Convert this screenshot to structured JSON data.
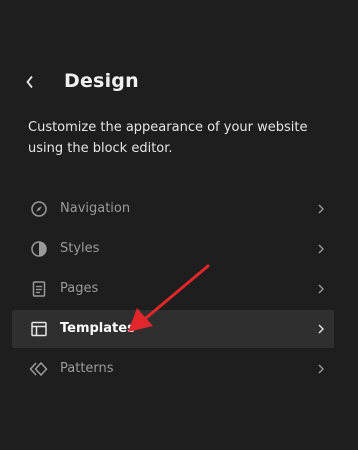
{
  "header": {
    "title": "Design",
    "description": "Customize the appearance of your website using the block editor."
  },
  "menu": {
    "items": [
      {
        "label": "Navigation",
        "icon": "navigation-compass-icon",
        "active": false
      },
      {
        "label": "Styles",
        "icon": "styles-half-circle-icon",
        "active": false
      },
      {
        "label": "Pages",
        "icon": "pages-document-icon",
        "active": false
      },
      {
        "label": "Templates",
        "icon": "templates-layout-icon",
        "active": true
      },
      {
        "label": "Patterns",
        "icon": "patterns-diamond-icon",
        "active": false
      }
    ]
  },
  "colors": {
    "background": "#1e1e1e",
    "active_row": "#2f2f2f",
    "annotation_arrow": "#e1262c"
  }
}
